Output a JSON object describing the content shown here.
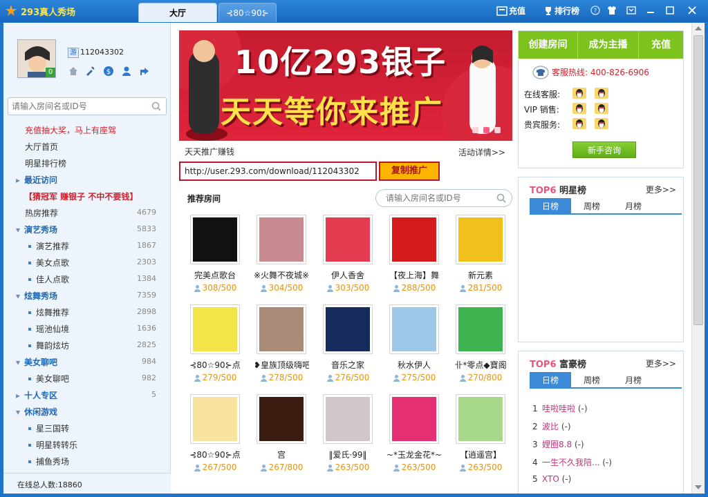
{
  "app": {
    "title": "293真人秀场"
  },
  "tabs": [
    {
      "label": "大厅"
    },
    {
      "label": "⊰80☆90⊱点..."
    }
  ],
  "titlebar": {
    "recharge": "充值",
    "ranking": "排行榜"
  },
  "user": {
    "guest_tag": "游",
    "id": "112043302",
    "level": "0"
  },
  "left_search": {
    "placeholder": "请输入房间名或ID号"
  },
  "nav": {
    "promo": "充值抽大奖，马上有座驾",
    "home": "大厅首页",
    "star_rank": "明星排行榜",
    "recent": "最近访问",
    "guess": "【猜冠军 赚银子 不中不要钱】",
    "hot": {
      "label": "热房推荐",
      "count": "4679"
    },
    "groups": [
      {
        "label": "演艺秀场",
        "count": "5833",
        "subs": [
          {
            "label": "演艺推荐",
            "count": "1867"
          },
          {
            "label": "美女点歌",
            "count": "2303"
          },
          {
            "label": "佳人点歌",
            "count": "1384"
          }
        ]
      },
      {
        "label": "炫舞秀场",
        "count": "7359",
        "subs": [
          {
            "label": "炫舞推荐",
            "count": "2898"
          },
          {
            "label": "瑶池仙境",
            "count": "1636"
          },
          {
            "label": "舞韵炫坊",
            "count": "2825"
          }
        ]
      },
      {
        "label": "美女聊吧",
        "count": "984",
        "subs": [
          {
            "label": "美女聊吧",
            "count": "982"
          }
        ]
      },
      {
        "label": "十人专区",
        "count": "5",
        "subs": []
      },
      {
        "label": "休闲游戏",
        "count": "",
        "subs": [
          {
            "label": "星三国转",
            "count": ""
          },
          {
            "label": "明星转转乐",
            "count": ""
          },
          {
            "label": "捕鱼秀场",
            "count": ""
          }
        ]
      }
    ],
    "online_total": "在线总人数:18860"
  },
  "banner": {
    "headline": "10亿293银子",
    "subline": "天天等你来推广"
  },
  "promo": {
    "title": "天天推广赚钱",
    "more": "活动详情>>",
    "url": "http://user.293.com/download/112043302",
    "copy": "复制推广"
  },
  "rooms_section": {
    "title": "推荐房间",
    "search_placeholder": "请输入房间名或ID号"
  },
  "rooms": [
    {
      "name": "完美点歌台",
      "count": "308/500",
      "color": "#111111"
    },
    {
      "name": "※火舞不夜城※",
      "count": "304/500",
      "color": "#c98a8f"
    },
    {
      "name": "伊人香舍",
      "count": "303/500",
      "color": "#e33b4f"
    },
    {
      "name": "【夜上海】舞",
      "count": "288/500",
      "color": "#d41a1a"
    },
    {
      "name": "新元素",
      "count": "281/500",
      "color": "#f2c01a"
    },
    {
      "name": "⊰80☆90⊱点",
      "count": "279/500",
      "color": "#f3e44a"
    },
    {
      "name": "❥皇族顶级嗨吧",
      "count": "278/500",
      "color": "#a88a76"
    },
    {
      "name": "音乐之家",
      "count": "276/500",
      "color": "#162a5c"
    },
    {
      "name": "秋水伊人",
      "count": "275/500",
      "color": "#9fc7e8"
    },
    {
      "name": "卝*零点◆寶阁",
      "count": "270/800",
      "color": "#3fb34f"
    },
    {
      "name": "⊰80☆90⊱点",
      "count": "267/500",
      "color": "#f7e2a0"
    },
    {
      "name": "宫",
      "count": "267/800",
      "color": "#3a1d10"
    },
    {
      "name": "‖爱氏·99‖",
      "count": "263/500",
      "color": "#cfc7c7"
    },
    {
      "name": "~*玉龙金花*~",
      "count": "263/500",
      "color": "#e52f73"
    },
    {
      "name": "【逍遥宫】",
      "count": "263/500",
      "color": "#a7d889"
    }
  ],
  "right": {
    "buttons": [
      "创建房间",
      "成为主播",
      "充值"
    ],
    "hotline": "客服热线: 400-826-6906",
    "services": [
      "在线客服:",
      "VIP 销售:",
      "贵宾服务:"
    ],
    "newbie": "新手咨询"
  },
  "star_rank": {
    "title_top": "TOP6",
    "title_rest": " 明星榜",
    "more": "更多>>",
    "tabs": [
      "日榜",
      "周榜",
      "月榜"
    ]
  },
  "rich_rank": {
    "title_top": "TOP6",
    "title_rest": " 富豪榜",
    "more": "更多>>",
    "tabs": [
      "日榜",
      "周榜",
      "月榜"
    ],
    "rows": [
      {
        "num": "1",
        "name": "哇啦哇啦",
        "suffix": " (-)"
      },
      {
        "num": "2",
        "name": "波比",
        "suffix": " (-)"
      },
      {
        "num": "3",
        "name": "娌圈8.8",
        "suffix": " (-)"
      },
      {
        "num": "4",
        "name": "一生不久我陪...",
        "suffix": " (-)"
      },
      {
        "num": "5",
        "name": "XTO",
        "suffix": " (-)"
      }
    ]
  },
  "colors": {
    "brand": "#1f73c9",
    "accent_red": "#d4202b",
    "green": "#7dc31e",
    "rank_pink": "#e8557a"
  }
}
